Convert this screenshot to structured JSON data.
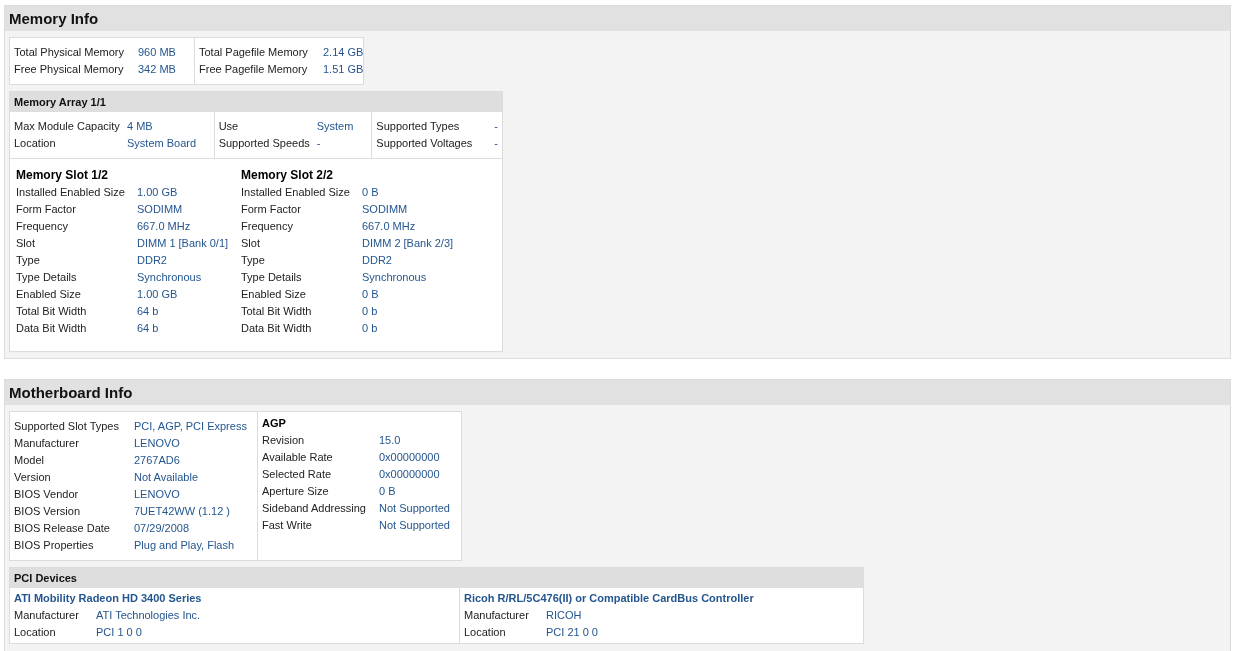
{
  "memory_info": {
    "title": "Memory Info",
    "summary": [
      [
        {
          "label": "Total Physical Memory",
          "value": "960 MB"
        },
        {
          "label": "Free Physical Memory",
          "value": "342 MB"
        }
      ],
      [
        {
          "label": "Total Pagefile Memory",
          "value": "2.14 GB"
        },
        {
          "label": "Free Pagefile Memory",
          "value": "1.51 GB"
        }
      ]
    ],
    "memory_array": {
      "title": "Memory Array 1/1",
      "properties": [
        [
          {
            "label": "Max Module Capacity",
            "value": "4 MB"
          },
          {
            "label": "Location",
            "value": "System Board"
          }
        ],
        [
          {
            "label": "Use",
            "value": "System"
          },
          {
            "label": "Supported Speeds",
            "value": "-"
          }
        ],
        [
          {
            "label": "Supported Types",
            "value": "-"
          },
          {
            "label": "Supported Voltages",
            "value": "-"
          }
        ]
      ],
      "slots": [
        {
          "title": "Memory Slot 1/2",
          "rows": [
            {
              "label": "Installed Enabled Size",
              "value": "1.00 GB"
            },
            {
              "label": "Form Factor",
              "value": "SODIMM"
            },
            {
              "label": "Frequency",
              "value": "667.0 MHz"
            },
            {
              "label": "Slot",
              "value": "DIMM 1 [Bank 0/1]"
            },
            {
              "label": "Type",
              "value": "DDR2"
            },
            {
              "label": "Type Details",
              "value": "Synchronous"
            },
            {
              "label": "Enabled Size",
              "value": "1.00 GB"
            },
            {
              "label": "Total Bit Width",
              "value": "64 b"
            },
            {
              "label": "Data Bit Width",
              "value": "64 b"
            }
          ]
        },
        {
          "title": "Memory Slot 2/2",
          "rows": [
            {
              "label": "Installed Enabled Size",
              "value": "0 B"
            },
            {
              "label": "Form Factor",
              "value": "SODIMM"
            },
            {
              "label": "Frequency",
              "value": "667.0 MHz"
            },
            {
              "label": "Slot",
              "value": "DIMM 2 [Bank 2/3]"
            },
            {
              "label": "Type",
              "value": "DDR2"
            },
            {
              "label": "Type Details",
              "value": "Synchronous"
            },
            {
              "label": "Enabled Size",
              "value": "0 B"
            },
            {
              "label": "Total Bit Width",
              "value": "0 b"
            },
            {
              "label": "Data Bit Width",
              "value": "0 b"
            }
          ]
        }
      ]
    }
  },
  "motherboard_info": {
    "title": "Motherboard Info",
    "properties": [
      {
        "label": "Supported Slot Types",
        "value": "PCI, AGP, PCI Express"
      },
      {
        "label": "Manufacturer",
        "value": "LENOVO"
      },
      {
        "label": "Model",
        "value": "2767AD6"
      },
      {
        "label": "Version",
        "value": "Not Available"
      },
      {
        "label": "BIOS Vendor",
        "value": "LENOVO"
      },
      {
        "label": "BIOS Version",
        "value": "7UET42WW (1.12 )"
      },
      {
        "label": "BIOS Release Date",
        "value": "07/29/2008"
      },
      {
        "label": "BIOS Properties",
        "value": "Plug and Play, Flash"
      }
    ],
    "agp": {
      "title": "AGP",
      "rows": [
        {
          "label": "Revision",
          "value": "15.0"
        },
        {
          "label": "Available Rate",
          "value": "0x00000000"
        },
        {
          "label": "Selected Rate",
          "value": "0x00000000"
        },
        {
          "label": "Aperture Size",
          "value": "0 B"
        },
        {
          "label": "Sideband Addressing",
          "value": "Not Supported"
        },
        {
          "label": "Fast Write",
          "value": "Not Supported"
        }
      ]
    },
    "pci_devices": {
      "title": "PCI Devices",
      "devices": [
        {
          "name": "ATI Mobility Radeon HD 3400 Series",
          "rows": [
            {
              "label": "Manufacturer",
              "value": "ATI Technologies Inc."
            },
            {
              "label": "Location",
              "value": "PCI 1 0 0"
            }
          ]
        },
        {
          "name": "Ricoh R/RL/5C476(II) or Compatible CardBus Controller",
          "rows": [
            {
              "label": "Manufacturer",
              "value": "RICOH"
            },
            {
              "label": "Location",
              "value": "PCI 21 0 0"
            }
          ]
        }
      ]
    }
  }
}
